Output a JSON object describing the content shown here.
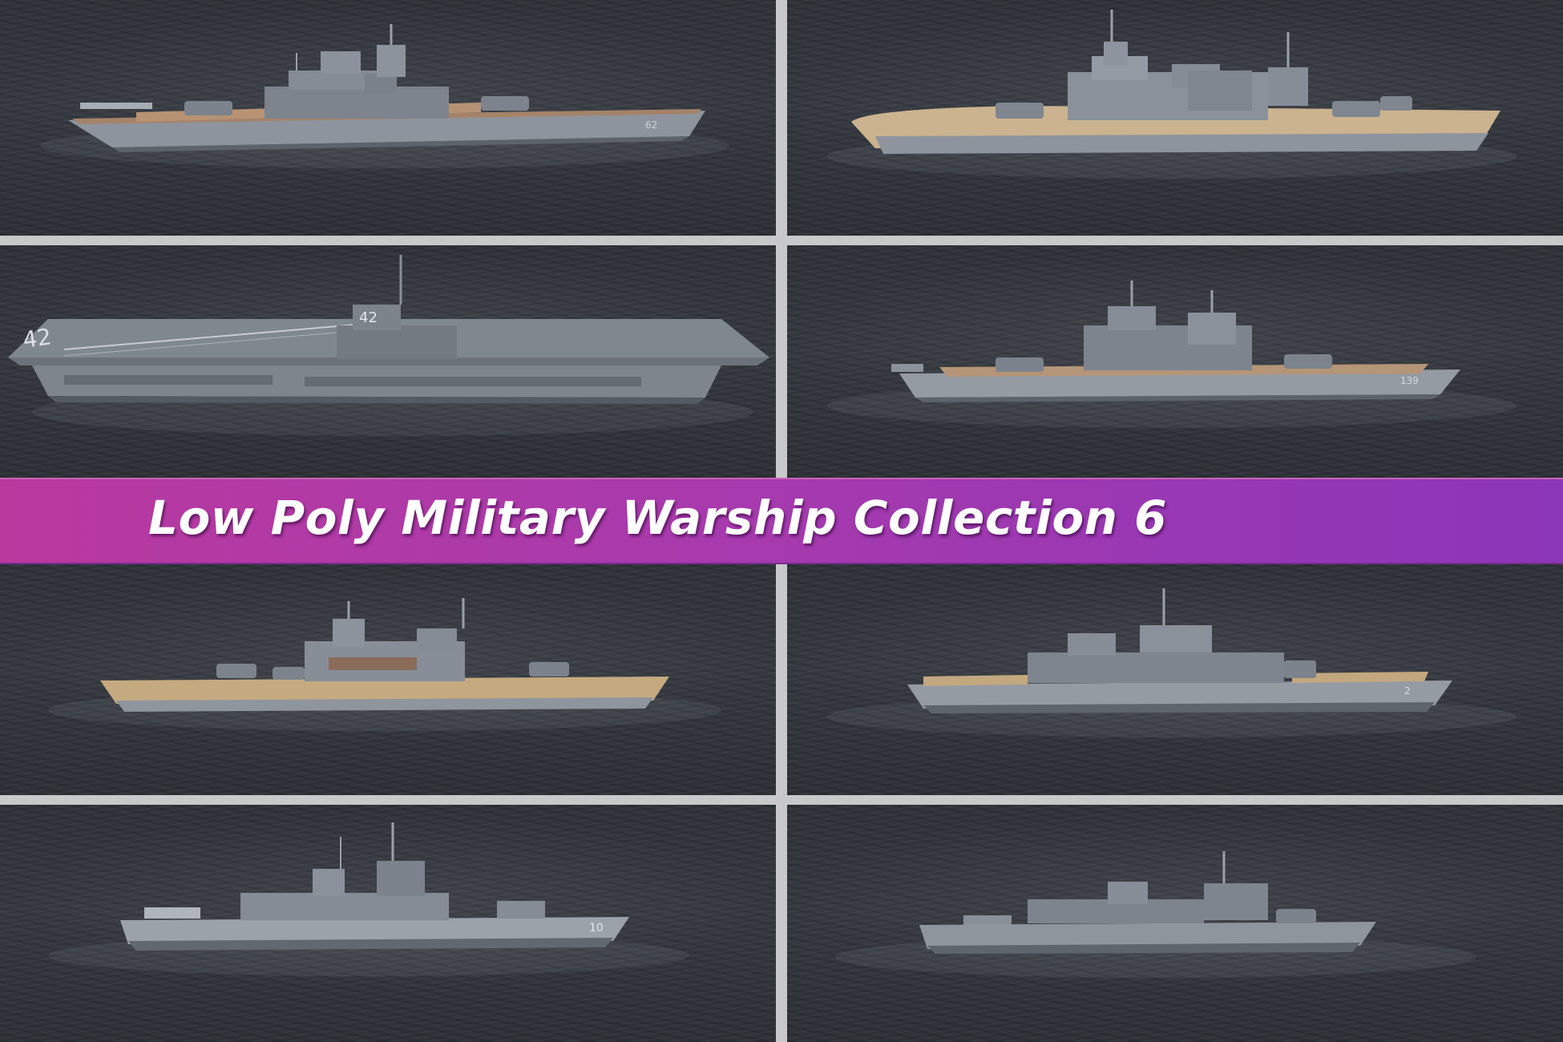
{
  "banner": {
    "title": "Low Poly Military Warship Collection 6",
    "colors": [
      "#b9399f",
      "#8c36b9"
    ]
  },
  "grid": {
    "columns": 2,
    "rows": 4,
    "panels": [
      {
        "content": "battleship, grey hull, wooden deck",
        "hull_number": "62"
      },
      {
        "content": "battleship, light grey hull, tan deck",
        "hull_number": ""
      },
      {
        "content": "aircraft carrier, angled flight deck",
        "hull_number": "42"
      },
      {
        "content": "heavy cruiser",
        "hull_number": "139"
      },
      {
        "content": "battleship, tan deck",
        "hull_number": ""
      },
      {
        "content": "light cruiser",
        "hull_number": "2"
      },
      {
        "content": "guided missile cruiser",
        "hull_number": "10"
      },
      {
        "content": "destroyer",
        "hull_number": ""
      }
    ]
  },
  "colors": {
    "water": "#2f333a",
    "gutter": "#c9c9cb",
    "hull": "#8e949d",
    "deck_wood": "#b8956a",
    "superstructure": "#7d848e"
  }
}
